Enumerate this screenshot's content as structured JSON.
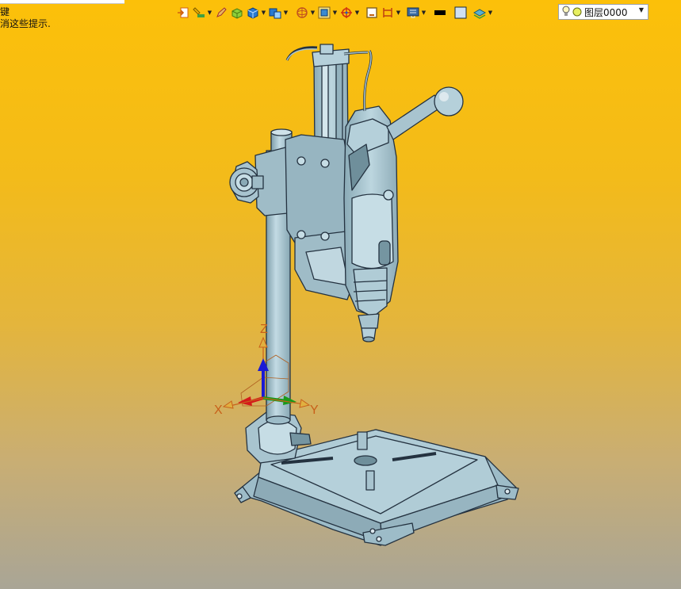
{
  "hint": {
    "line1": "键",
    "line2": "消这些提示."
  },
  "toolbar": {
    "icons": [
      {
        "name": "exit-sketch-icon",
        "dropdown": false
      },
      {
        "name": "paint-brush-icon",
        "dropdown": true
      },
      {
        "name": "pencil-icon",
        "dropdown": false
      },
      {
        "name": "solid-box-icon",
        "dropdown": false
      },
      {
        "name": "shaded-cube-icon",
        "dropdown": true
      },
      {
        "name": "render-mode-icon",
        "dropdown": true
      },
      {
        "name": "sphere-wire-icon",
        "dropdown": true
      },
      {
        "name": "fit-view-icon",
        "dropdown": true
      },
      {
        "name": "snap-target-icon",
        "dropdown": true
      },
      {
        "name": "frame-icon",
        "dropdown": false
      },
      {
        "name": "dimension-icon",
        "dropdown": true
      },
      {
        "name": "monitor-grid-icon",
        "dropdown": true
      },
      {
        "name": "line-color-swatch-icon",
        "dropdown": false
      },
      {
        "name": "fill-color-swatch-icon",
        "dropdown": false
      },
      {
        "name": "layer-stack-icon",
        "dropdown": true
      }
    ]
  },
  "layer_select": {
    "value": "图层0000"
  },
  "triad": {
    "x_label": "X",
    "y_label": "Y",
    "z_label": "Z"
  },
  "colors": {
    "model_fill": "#a8c4cf",
    "model_edge": "#243240",
    "axis_x": "#d41a1a",
    "axis_y": "#1a9a1a",
    "axis_z": "#1a1ad4",
    "axis_label": "#c8601a"
  }
}
